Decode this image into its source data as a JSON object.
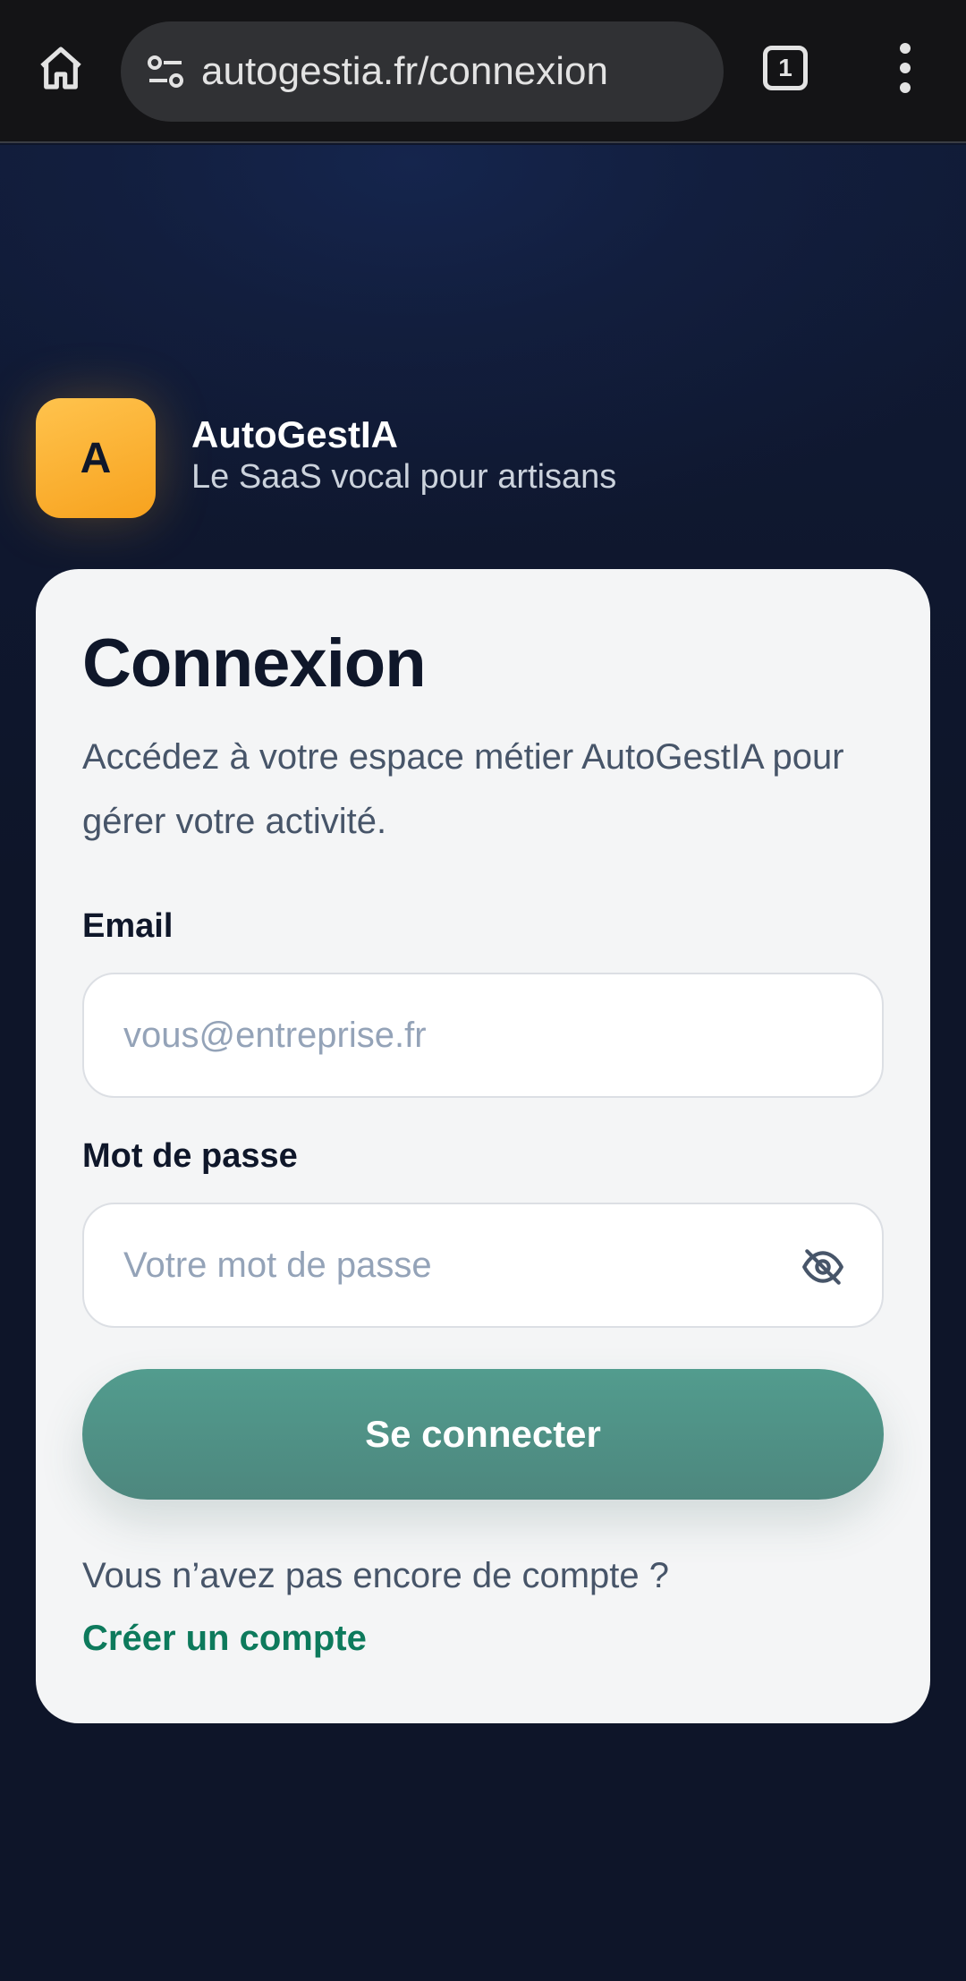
{
  "browser": {
    "url": "autogestia.fr/connexion",
    "tab_count": "1",
    "icons": {
      "home": "home-icon",
      "site_settings": "site-settings-icon",
      "menu": "more-vertical-icon"
    }
  },
  "brand": {
    "logo_letter": "A",
    "name": "AutoGestIA",
    "tagline": "Le SaaS vocal pour artisans",
    "logo_color": "#f7a21e"
  },
  "login": {
    "title": "Connexion",
    "subtitle": "Accédez à votre espace métier AutoGestIA pour gérer votre activité.",
    "email": {
      "label": "Email",
      "placeholder": "vous@entreprise.fr",
      "value": ""
    },
    "password": {
      "label": "Mot de passe",
      "placeholder": "Votre mot de passe",
      "value": "",
      "toggle_icon": "eye-off-icon"
    },
    "submit_label": "Se connecter",
    "no_account_text": "Vous n’avez pas encore de compte ?",
    "create_account_label": "Créer un compte"
  },
  "colors": {
    "background": "#0e1529",
    "card": "#f4f5f6",
    "primary_button": "#4f9489",
    "link": "#0d7a5c"
  }
}
